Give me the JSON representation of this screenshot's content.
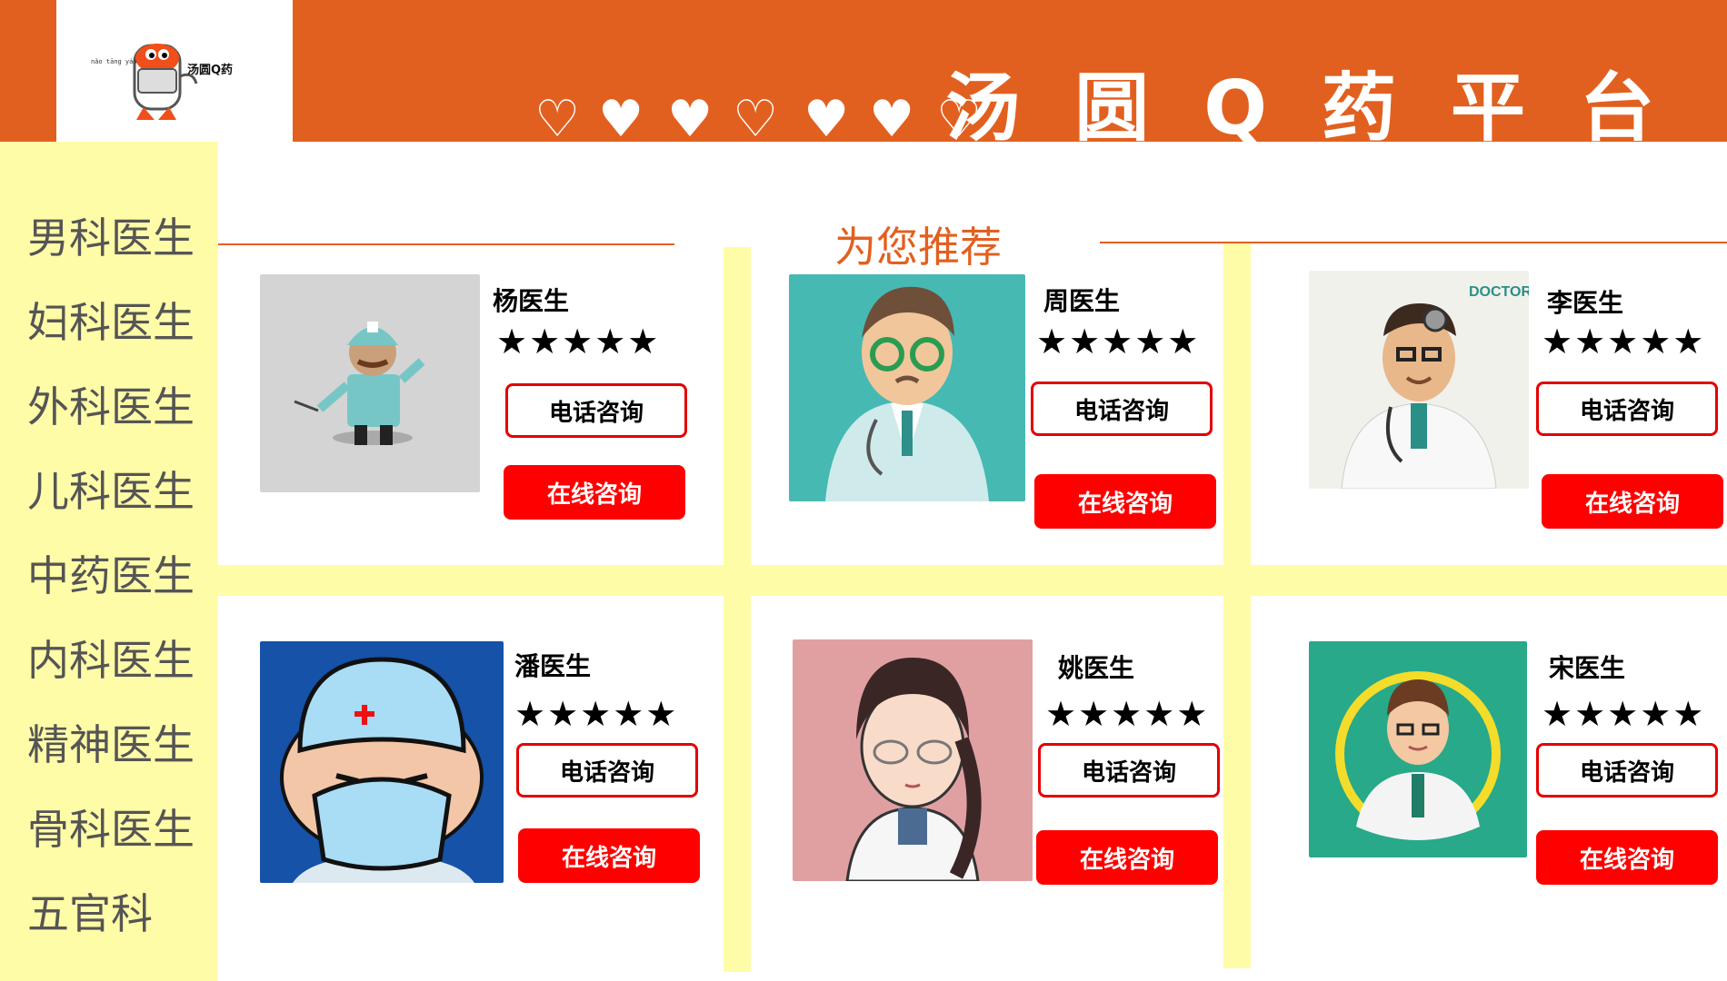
{
  "header": {
    "title": "汤圆Q药平台",
    "logo_text": "汤圆Q药",
    "logo_small": "nǎo tāng yáo",
    "accent": "#e2601f"
  },
  "sidebar": {
    "items": [
      {
        "label": "男科医生"
      },
      {
        "label": "妇科医生"
      },
      {
        "label": "外科医生"
      },
      {
        "label": "儿科医生"
      },
      {
        "label": "中药医生"
      },
      {
        "label": "内科医生"
      },
      {
        "label": "精神医生"
      },
      {
        "label": "骨科医生"
      },
      {
        "label": "五官科"
      }
    ]
  },
  "main": {
    "section_title": "为您推荐",
    "doctors": [
      {
        "name": "杨医生",
        "rating": "★★★★★",
        "phone_label": "电话咨询",
        "online_label": "在线咨询",
        "icon": "doctor-nurse-avatar"
      },
      {
        "name": "周医生",
        "rating": "★★★★★",
        "phone_label": "电话咨询",
        "online_label": "在线咨询",
        "icon": "doctor-glasses-avatar"
      },
      {
        "name": "李医生",
        "rating": "★★★★★",
        "phone_label": "电话咨询",
        "online_label": "在线咨询",
        "badge": "DOCTOR VECTOR",
        "icon": "doctor-headlamp-avatar"
      },
      {
        "name": "潘医生",
        "rating": "★★★★★",
        "phone_label": "电话咨询",
        "online_label": "在线咨询",
        "icon": "surgeon-mask-avatar"
      },
      {
        "name": "姚医生",
        "rating": "★★★★★",
        "phone_label": "电话咨询",
        "online_label": "在线咨询",
        "icon": "female-doctor-avatar"
      },
      {
        "name": "宋医生",
        "rating": "★★★★★",
        "phone_label": "电话咨询",
        "online_label": "在线咨询",
        "icon": "doctor-circle-avatar"
      }
    ]
  },
  "colors": {
    "sidebar_bg": "#fffca8",
    "button_red": "#ff0000",
    "header_orange": "#e2601f"
  }
}
